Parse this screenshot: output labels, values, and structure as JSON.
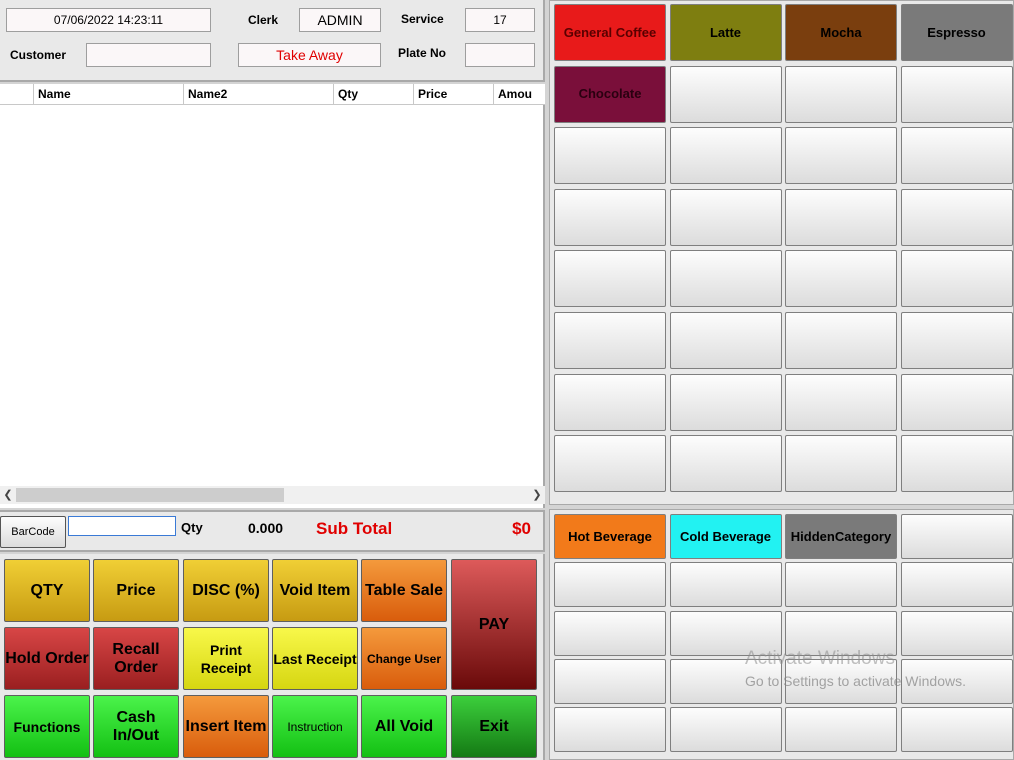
{
  "header": {
    "datetime": "07/06/2022 14:23:11",
    "clerk_label": "Clerk",
    "clerk_value": "ADMIN",
    "service_label": "Service",
    "service_value": "17",
    "customer_label": "Customer",
    "customer_value": "",
    "order_type": "Take Away",
    "plate_label": "Plate No",
    "plate_value": ""
  },
  "grid": {
    "columns": [
      "",
      "Name",
      "Name2",
      "Qty",
      "Price",
      "Amou"
    ]
  },
  "strip": {
    "barcode_label": "BarCode",
    "barcode_value": "",
    "qty_label": "Qty",
    "qty_value": "0.000",
    "subtotal_label": "Sub Total",
    "subtotal_value": "$0"
  },
  "functions": {
    "qty": "QTY",
    "price": "Price",
    "disc": "DISC (%)",
    "void_item": "Void Item",
    "table_sale": "Table Sale",
    "pay": "PAY",
    "hold_order": "Hold Order",
    "recall_order": "Recall Order",
    "print_receipt": "Print Receipt",
    "last_receipt": "Last Receipt",
    "change_user": "Change User",
    "functions": "Functions",
    "cash_inout": "Cash In/Out",
    "insert_item": "Insert Item",
    "instruction": "Instruction",
    "all_void": "All Void",
    "exit": "Exit"
  },
  "products": [
    {
      "label": "General Coffee",
      "color": "#e81a1a"
    },
    {
      "label": "Latte",
      "color": "#7e7e10"
    },
    {
      "label": "Mocha",
      "color": "#7a3e0e"
    },
    {
      "label": "Espresso",
      "color": "#7a7a7a"
    },
    {
      "label": "Chocolate",
      "color": "#7a0f3a"
    }
  ],
  "categories": [
    {
      "label": "Hot Beverage",
      "color": "#f27a1a"
    },
    {
      "label": "Cold Beverage",
      "color": "#22f2f2"
    },
    {
      "label": "HiddenCategory",
      "color": "#7a7a7a"
    }
  ],
  "watermark": {
    "title": "Activate Windows",
    "subtitle": "Go to Settings to activate Windows."
  }
}
